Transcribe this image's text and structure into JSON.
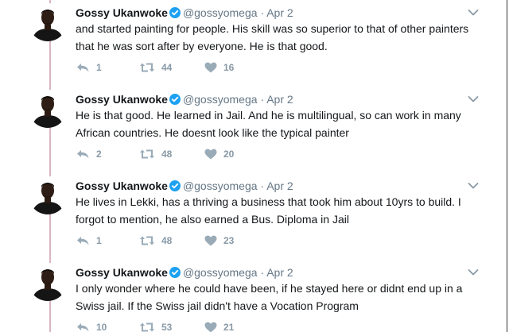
{
  "tweets": [
    {
      "author_name": "Gossy Ukanwoke",
      "handle": "@gossyomega",
      "separator": "·",
      "date": "Apr 2",
      "text": "and started painting for people. His skill was so superior to that of other painters that he was sort after by everyone. He is that good.",
      "replies": "1",
      "retweets": "44",
      "likes": "16"
    },
    {
      "author_name": "Gossy Ukanwoke",
      "handle": "@gossyomega",
      "separator": "·",
      "date": "Apr 2",
      "text": "He is that good. He learned in Jail. And he is multilingual, so can work in many African countries. He doesnt look like the typical  painter",
      "replies": "2",
      "retweets": "48",
      "likes": "20"
    },
    {
      "author_name": "Gossy Ukanwoke",
      "handle": "@gossyomega",
      "separator": "·",
      "date": "Apr 2",
      "text": "He lives in Lekki, has a thriving a business that took him about 10yrs to build.  I forgot to mention, he also earned a Bus. Diploma in Jail",
      "replies": "1",
      "retweets": "48",
      "likes": "23"
    },
    {
      "author_name": "Gossy Ukanwoke",
      "handle": "@gossyomega",
      "separator": "·",
      "date": "Apr 2",
      "text": "I only wonder where he could have been, if he stayed here or didnt end up in a Swiss jail. If the Swiss jail didn't have a Vocation Program",
      "replies": "10",
      "retweets": "53",
      "likes": "21"
    }
  ],
  "colors": {
    "text": "#14171a",
    "muted": "#657786",
    "action": "#8899a6",
    "verified": "#1da1f2",
    "thread_line": "#d9b6c0"
  },
  "icons": {
    "avatar": "avatar",
    "verified": "verified-badge-icon",
    "menu": "chevron-down-icon",
    "reply": "reply-icon",
    "retweet": "retweet-icon",
    "like": "heart-icon"
  }
}
